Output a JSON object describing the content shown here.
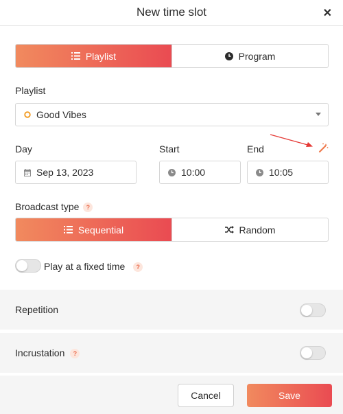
{
  "dialog": {
    "title": "New time slot"
  },
  "slot_type": {
    "options": [
      "Playlist",
      "Program"
    ],
    "selected": "Playlist"
  },
  "playlist": {
    "label": "Playlist",
    "value": "Good Vibes"
  },
  "day": {
    "label": "Day",
    "value": "Sep 13, 2023"
  },
  "start": {
    "label": "Start",
    "value": "10:00"
  },
  "end": {
    "label": "End",
    "value": "10:05"
  },
  "broadcast_type": {
    "label": "Broadcast type",
    "help": "?",
    "options": [
      "Sequential",
      "Random"
    ],
    "selected": "Sequential"
  },
  "fixed_time": {
    "label": "Play at a fixed time",
    "help": "?",
    "enabled": false
  },
  "repetition": {
    "label": "Repetition",
    "enabled": false
  },
  "incrustation": {
    "label": "Incrustation",
    "help": "?",
    "enabled": false
  },
  "footer": {
    "cancel_label": "Cancel",
    "save_label": "Save"
  },
  "colors": {
    "accent_start": "#f18a5e",
    "accent_end": "#ea4b52",
    "annotation_arrow": "#e53935"
  }
}
